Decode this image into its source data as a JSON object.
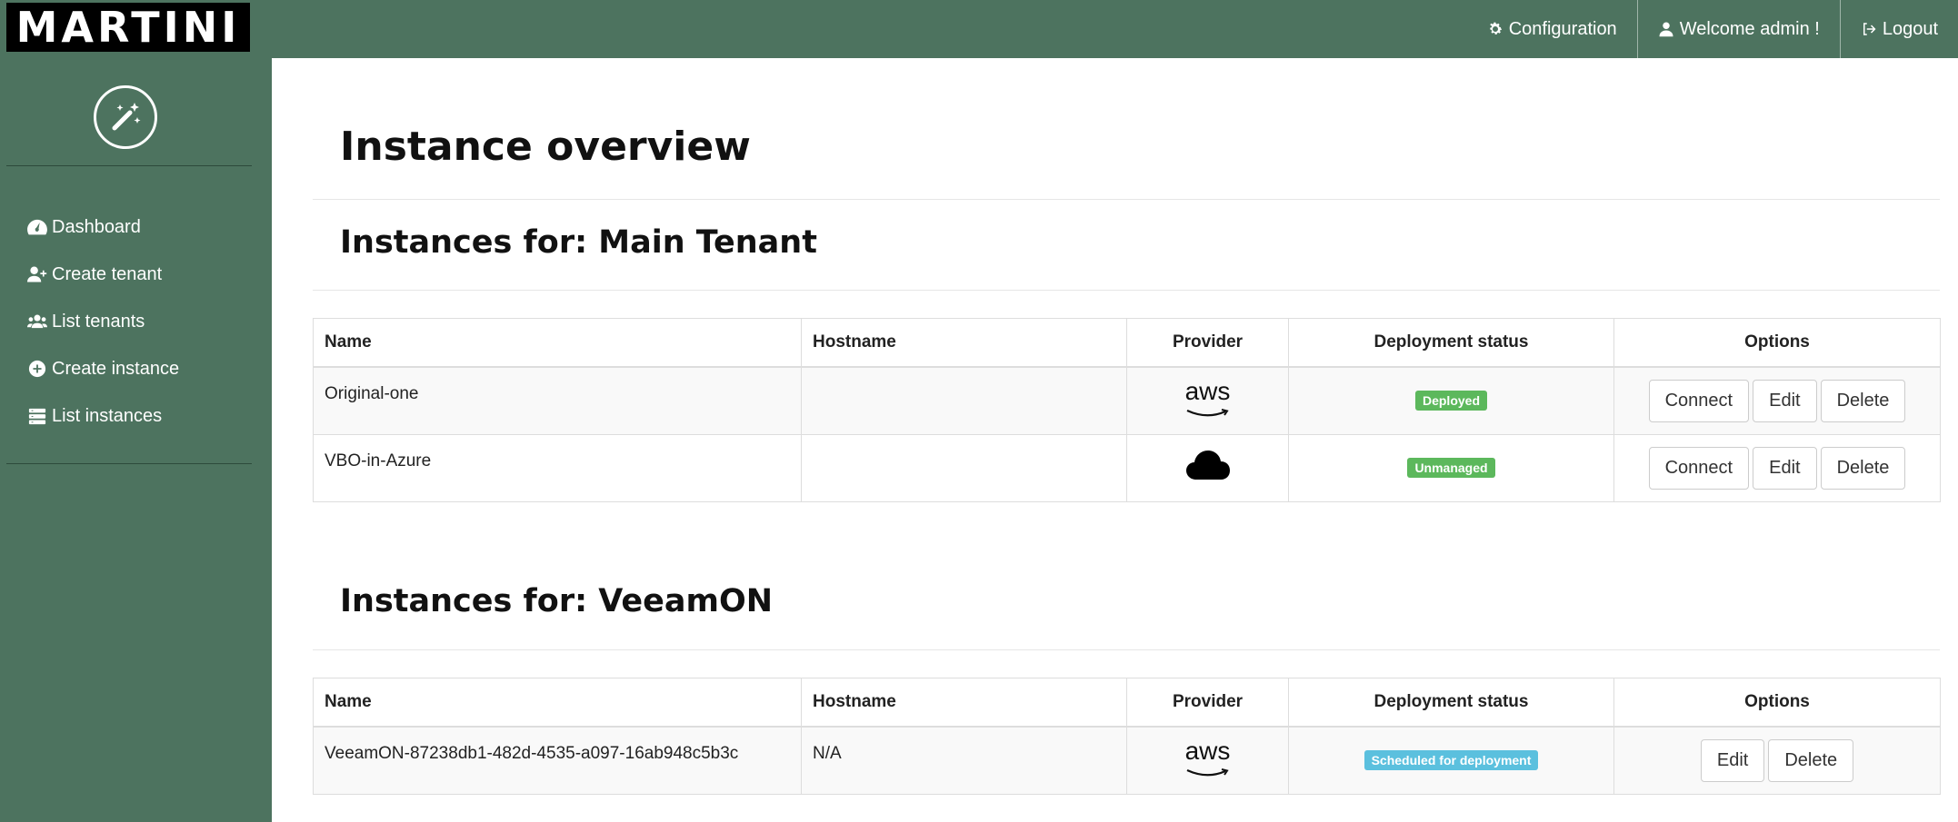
{
  "app": {
    "logo": "MARTINI"
  },
  "topnav": {
    "configuration": "Configuration",
    "welcome": "Welcome admin !",
    "logout": "Logout"
  },
  "sidebar": {
    "items": [
      {
        "label": "Dashboard",
        "icon": "dashboard-icon"
      },
      {
        "label": "Create tenant",
        "icon": "user-plus-icon"
      },
      {
        "label": "List tenants",
        "icon": "users-icon"
      },
      {
        "label": "Create instance",
        "icon": "plus-circle-icon"
      },
      {
        "label": "List instances",
        "icon": "list-icon"
      }
    ]
  },
  "page": {
    "title": "Instance overview"
  },
  "columns": [
    "Name",
    "Hostname",
    "Provider",
    "Deployment status",
    "Options"
  ],
  "sections": [
    {
      "title": "Instances for: Main Tenant",
      "rows": [
        {
          "name": "Original-one",
          "hostname": "",
          "provider": "aws",
          "status": "Deployed",
          "status_color": "#5cb85c",
          "options": [
            "Connect",
            "Edit",
            "Delete"
          ]
        },
        {
          "name": "VBO-in-Azure",
          "hostname": "",
          "provider": "cloud",
          "status": "Unmanaged",
          "status_color": "#5cb85c",
          "options": [
            "Connect",
            "Edit",
            "Delete"
          ]
        }
      ]
    },
    {
      "title": "Instances for: VeeamON",
      "rows": [
        {
          "name": "VeeamON-87238db1-482d-4535-a097-16ab948c5b3c",
          "hostname": "N/A",
          "provider": "aws",
          "status": "Scheduled for deployment",
          "status_color": "#5bc0de",
          "options": [
            "Edit",
            "Delete"
          ]
        }
      ]
    }
  ],
  "colors": {
    "bar": "#4d735f",
    "deployed": "#5cb85c",
    "scheduled": "#5bc0de"
  }
}
